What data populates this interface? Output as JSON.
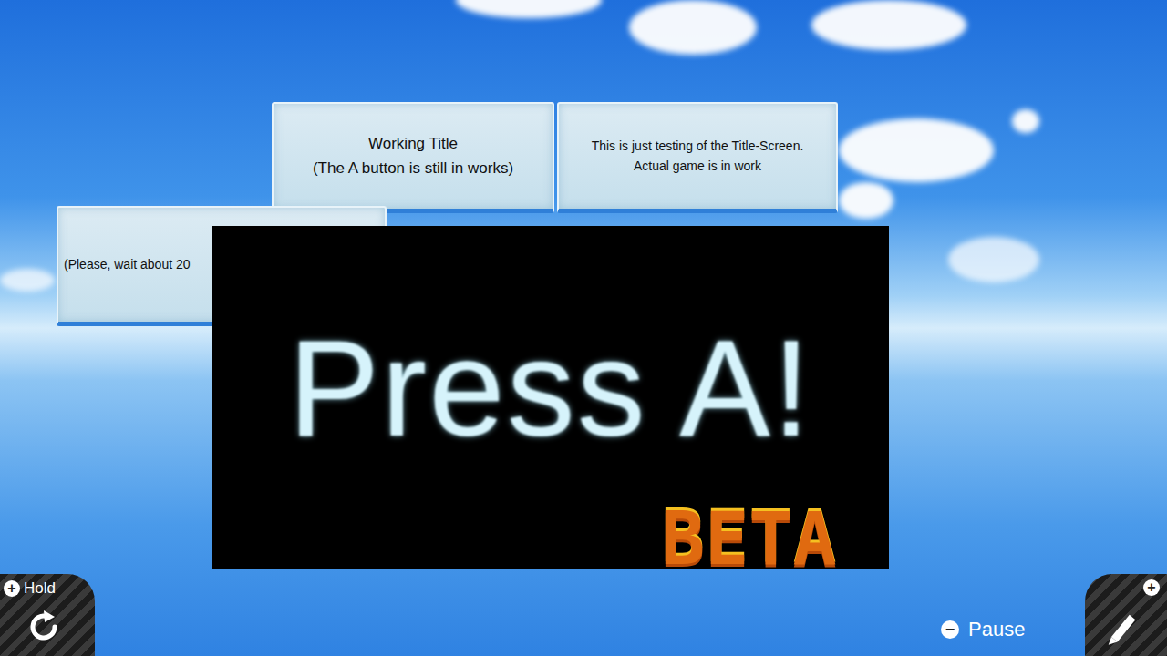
{
  "scene": {
    "blocks": [
      {
        "lines": [
          "Working Title",
          "(The A button is still in works)"
        ]
      },
      {
        "lines": [
          "This is just testing of the Title-Screen.",
          "Actual game is in work"
        ]
      },
      {
        "lines": [
          "(Please, wait about 20"
        ]
      }
    ]
  },
  "title_screen": {
    "prompt": "Press A!",
    "badge": "BETA"
  },
  "hud": {
    "hold": {
      "icon": "+",
      "label": "Hold"
    },
    "edit": {
      "icon": "+"
    },
    "pause": {
      "icon": "−",
      "label": "Pause"
    }
  }
}
